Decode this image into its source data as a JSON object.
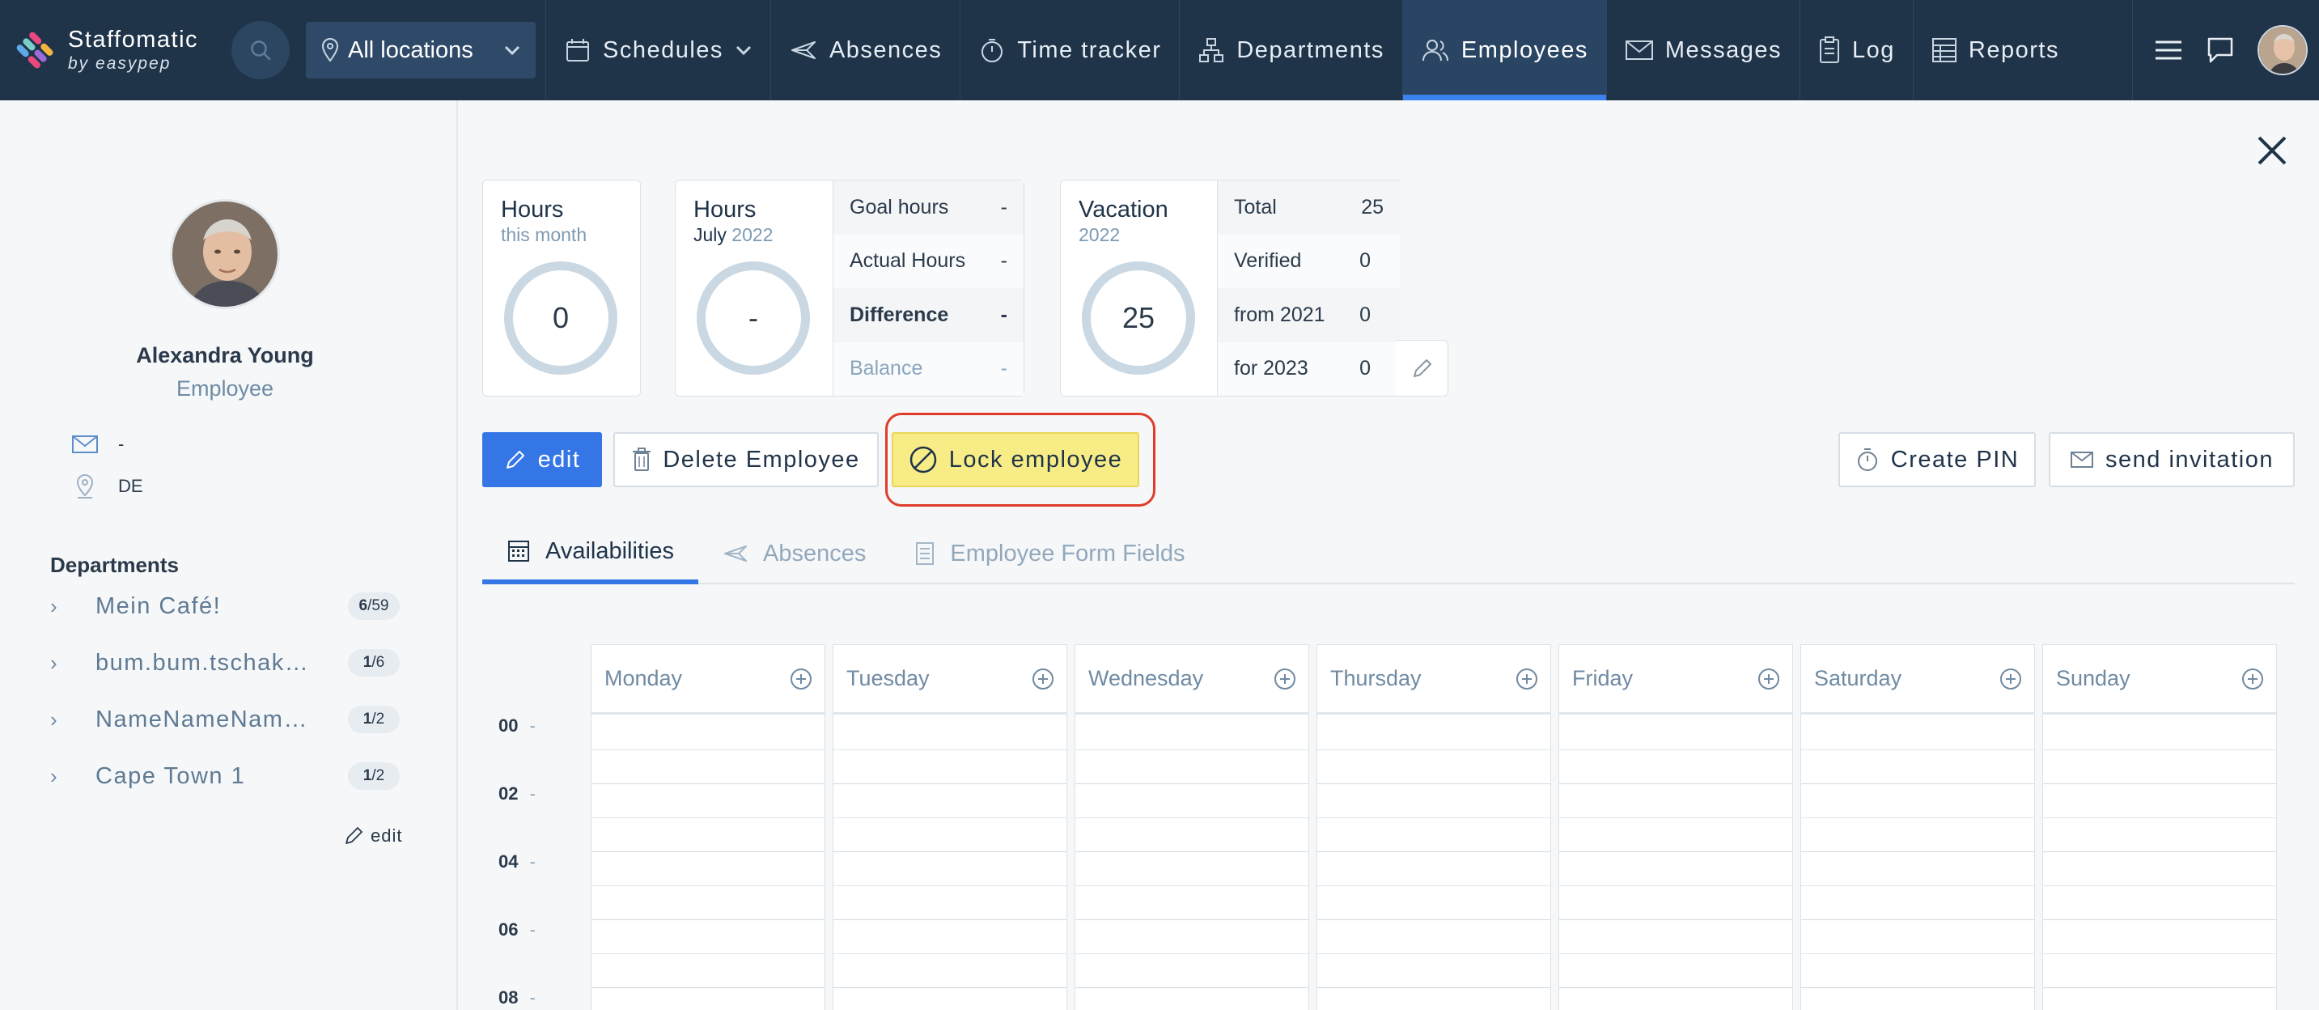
{
  "nav": {
    "brand_name": "Staffomatic",
    "brand_sub": "by easypep",
    "location_select": "All locations",
    "items": [
      {
        "label": "Schedules",
        "icon": "calendar-icon"
      },
      {
        "label": "Absences",
        "icon": "plane-icon"
      },
      {
        "label": "Time tracker",
        "icon": "stopwatch-icon"
      },
      {
        "label": "Departments",
        "icon": "org-chart-icon"
      },
      {
        "label": "Employees",
        "icon": "users-icon",
        "active": true
      },
      {
        "label": "Messages",
        "icon": "envelope-icon"
      },
      {
        "label": "Log",
        "icon": "clipboard-icon"
      },
      {
        "label": "Reports",
        "icon": "table-icon"
      }
    ],
    "accent": "#3c82ef",
    "background": "#1f3349"
  },
  "profile": {
    "name": "Alexandra Young",
    "role": "Employee",
    "email": "-",
    "location": "DE"
  },
  "departments": {
    "title": "Departments",
    "items": [
      {
        "name": "Mein Café!",
        "badge_a": "6",
        "badge_b": "/59"
      },
      {
        "name": "bum.bum.tschak…",
        "badge_a": "1",
        "badge_b": "/6"
      },
      {
        "name": "NameNameNam…",
        "badge_a": "1",
        "badge_b": "/2"
      },
      {
        "name": "Cape Town 1",
        "badge_a": "1",
        "badge_b": "/2"
      }
    ],
    "edit_label": "edit"
  },
  "stats": {
    "hours_month": {
      "title": "Hours",
      "subtitle": "this month",
      "value": "0"
    },
    "hours_period": {
      "title": "Hours",
      "month": "July",
      "year": "2022",
      "value": "-",
      "rows": [
        {
          "label": "Goal hours",
          "value": "-"
        },
        {
          "label": "Actual Hours",
          "value": "-"
        },
        {
          "label": "Difference",
          "value": "-"
        },
        {
          "label": "Balance",
          "value": "-"
        }
      ]
    },
    "vacation": {
      "title": "Vacation",
      "year": "2022",
      "value": "25",
      "rows": [
        {
          "label": "Total",
          "value": "25"
        },
        {
          "label": "Verified",
          "value": "0"
        },
        {
          "label": "from 2021",
          "value": "0"
        },
        {
          "label": "for 2023",
          "value": "0"
        }
      ]
    }
  },
  "actions": {
    "edit": "edit",
    "delete": "Delete Employee",
    "lock": "Lock employee",
    "create_pin": "Create PIN",
    "send_invitation": "send invitation",
    "lock_highlight_color": "#f7ec86",
    "primary_color": "#3576e6"
  },
  "tabs": [
    {
      "label": "Availabilities",
      "icon": "calendar-grid-icon",
      "active": true
    },
    {
      "label": "Absences",
      "icon": "plane-icon"
    },
    {
      "label": "Employee Form Fields",
      "icon": "document-icon"
    }
  ],
  "calendar": {
    "days": [
      "Monday",
      "Tuesday",
      "Wednesday",
      "Thursday",
      "Friday",
      "Saturday",
      "Sunday"
    ],
    "hours": [
      "00",
      "02",
      "04",
      "06",
      "08"
    ]
  }
}
